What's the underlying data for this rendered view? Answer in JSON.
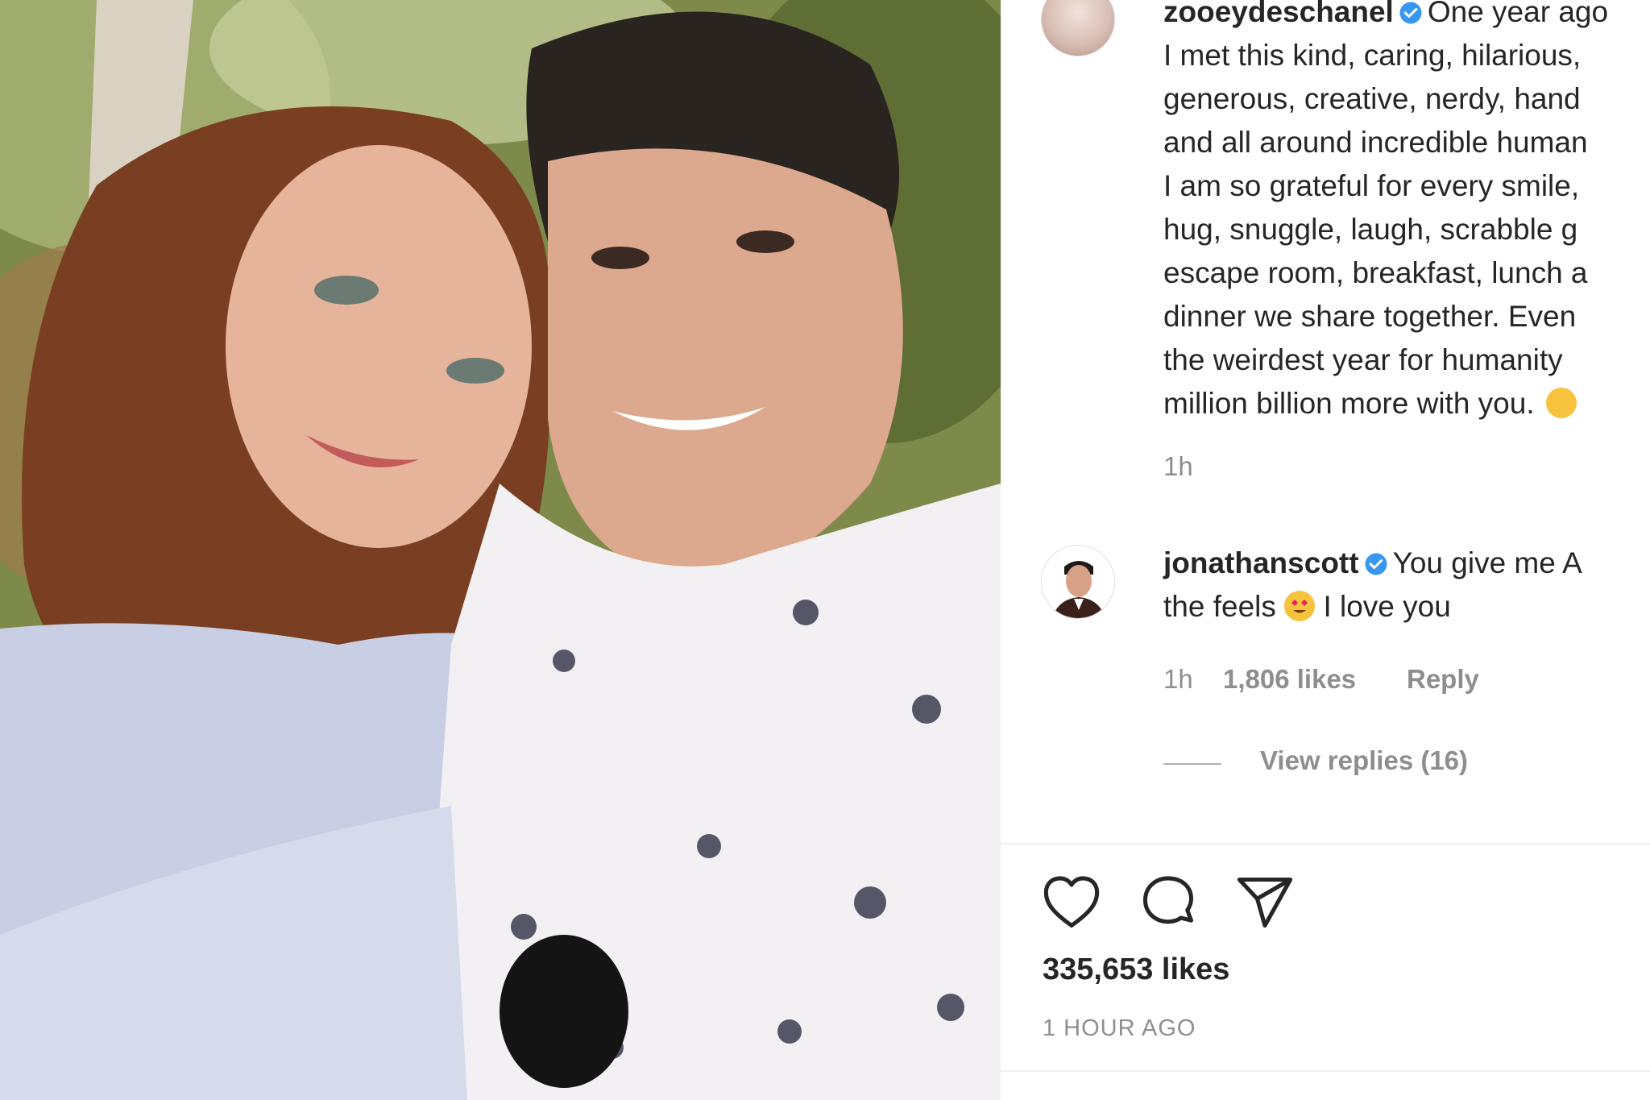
{
  "post": {
    "author": "zooeydeschanel",
    "caption_start": "One year ago",
    "caption_body": "I met this kind, caring, hilarious,\ngenerous, creative, nerdy, hand\nand all around incredible human\nI am so grateful for every smile,\nhug, snuggle, laugh, scrabble g\nescape room, breakfast, lunch a\ndinner we share together. Even\nthe weirdest year for humanity\nmillion billion more with you.",
    "caption_time": "1h"
  },
  "comment": {
    "author": "jonathanscott",
    "text_part1": "You give me A",
    "text_part2": "the feels",
    "text_part3": "I love you",
    "time": "1h",
    "likes": "1,806 likes",
    "reply_label": "Reply",
    "view_replies": "View replies (16)"
  },
  "footer": {
    "likes": "335,653 likes",
    "timestamp": "1 HOUR AGO"
  },
  "icons": {
    "like": "heart-icon",
    "comment": "comment-bubble-icon",
    "share": "paper-plane-icon",
    "verified": "verified-badge-icon"
  },
  "colors": {
    "verified_blue": "#3897f0",
    "muted": "#8e8e8e",
    "text": "#262626"
  }
}
